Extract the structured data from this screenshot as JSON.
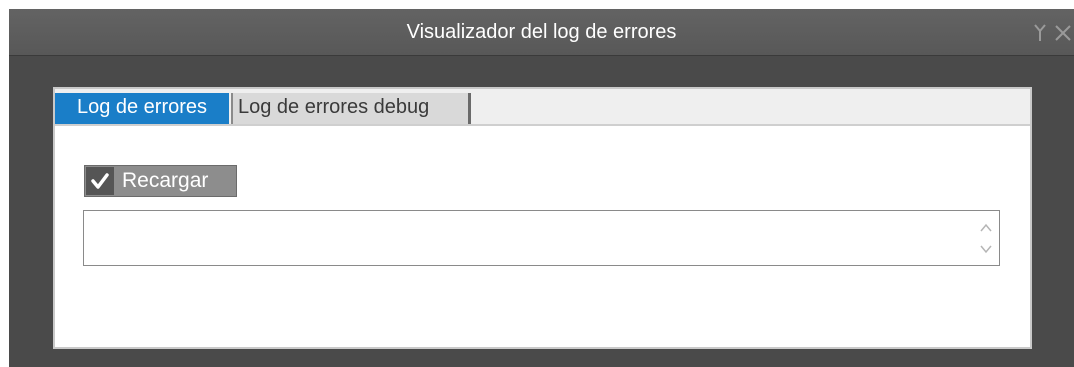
{
  "window": {
    "title": "Visualizador del log de errores"
  },
  "tabs": [
    {
      "label": "Log de errores",
      "active": true
    },
    {
      "label": "Log de errores debug",
      "active": false
    }
  ],
  "reload_checkbox": {
    "label": "Recargar",
    "checked": true
  },
  "log_textarea": {
    "value": ""
  },
  "icons": {
    "pin": "pin-icon",
    "close": "close-icon",
    "check": "checkmark-icon",
    "scroll_up": "chevron-up-icon",
    "scroll_down": "chevron-down-icon"
  },
  "colors": {
    "titlebar": "#5d5d5d",
    "window_bg": "#4a4a4a",
    "active_tab": "#1a7ec8",
    "inactive_tab": "#d9d9d9"
  }
}
